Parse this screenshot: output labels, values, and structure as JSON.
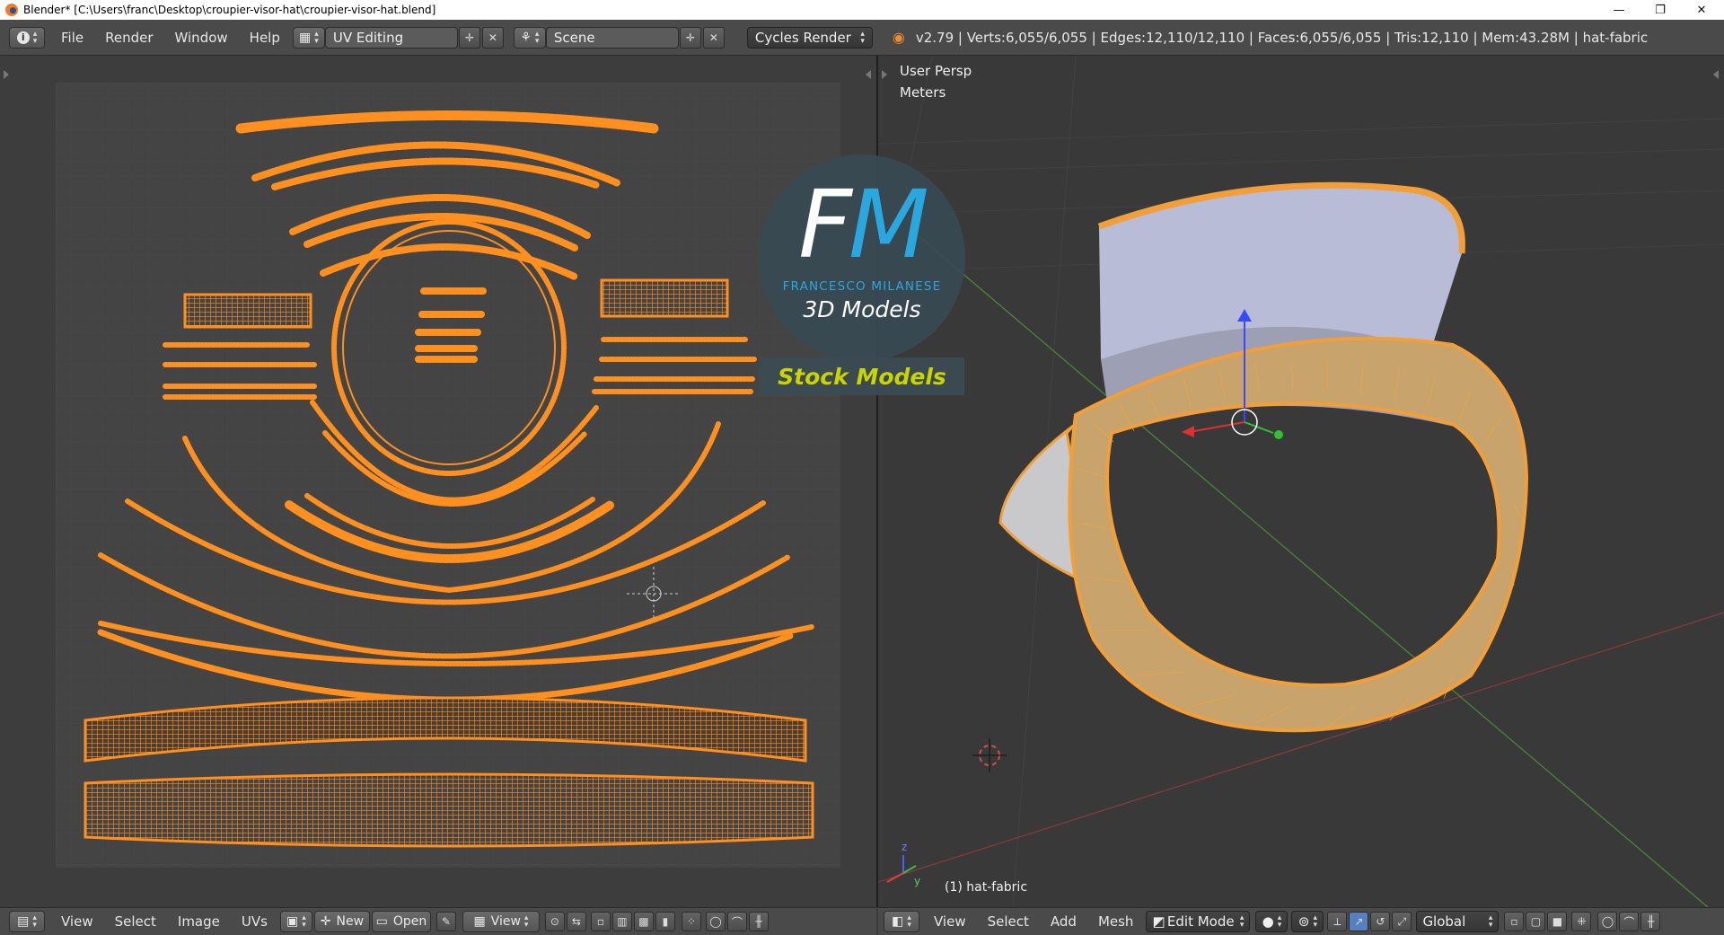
{
  "window": {
    "title": "Blender* [C:\\Users\\franc\\Desktop\\croupier-visor-hat\\croupier-visor-hat.blend]",
    "minimize": "—",
    "restore": "❐",
    "close": "✕"
  },
  "topbar": {
    "menus": [
      "File",
      "Render",
      "Window",
      "Help"
    ],
    "layout": "UV Editing",
    "scene": "Scene",
    "engine": "Cycles Render",
    "stats": "v2.79 | Verts:6,055/6,055 | Edges:12,110/12,110 | Faces:6,055/6,055 | Tris:12,110 | Mem:43.28M | hat-fabric"
  },
  "uv_editor": {
    "menus": [
      "View",
      "Select",
      "Image",
      "UVs"
    ],
    "new_label": "New",
    "open_label": "Open",
    "view_label": "View"
  },
  "viewport": {
    "projection": "User Persp",
    "units": "Meters",
    "object": "(1) hat-fabric",
    "menus": [
      "View",
      "Select",
      "Add",
      "Mesh"
    ],
    "mode": "Edit Mode",
    "orientation": "Global",
    "axis_y": "y",
    "axis_z": "z"
  },
  "watermark": {
    "letter1": "F",
    "letter2": "M",
    "name": "FRANCESCO MILANESE",
    "tagline": "3D Models",
    "badge": "Stock Models"
  },
  "colors": {
    "uv_orange": "#ff8f1e",
    "mesh_orange": "#f29f3a",
    "accent_blue": "#2aa7df",
    "badge_yellow": "#c9d400"
  }
}
